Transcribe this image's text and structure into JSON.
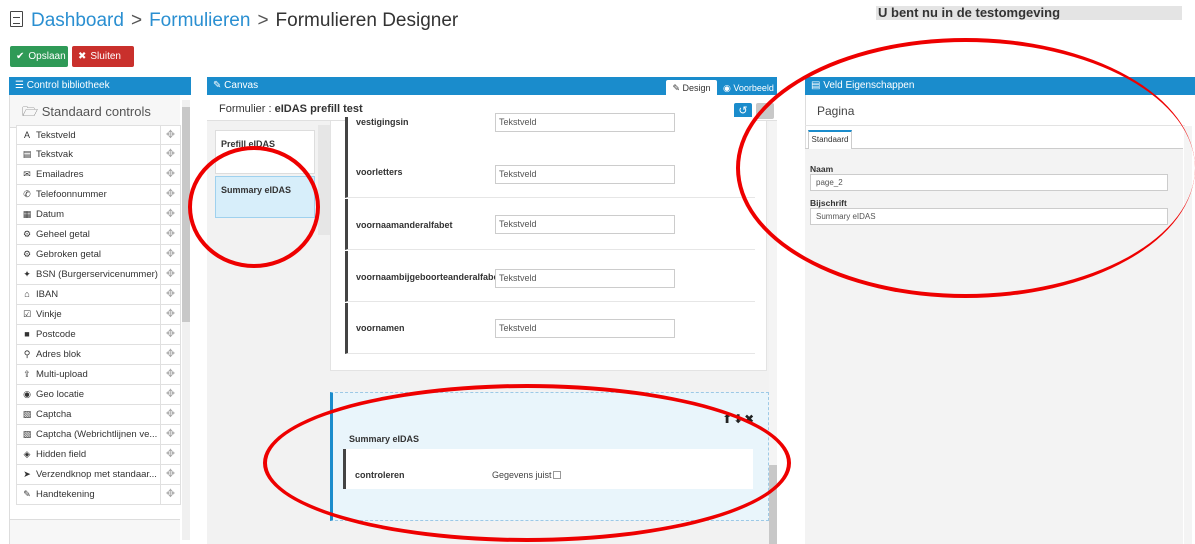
{
  "header": {
    "crumb_1": "Dashboard",
    "crumb_2": "Formulieren",
    "crumb_3": "Formulieren Designer",
    "separator": ">",
    "environment_banner": "U bent nu in de testomgeving"
  },
  "toolbar": {
    "save_label": "Opslaan",
    "close_label": "Sluiten"
  },
  "library": {
    "panel_title": "Control bibliotheek",
    "section_title": "Standaard controls",
    "items": [
      {
        "label": "Tekstveld",
        "icon": "A"
      },
      {
        "label": "Tekstvak",
        "icon": "▤"
      },
      {
        "label": "Emailadres",
        "icon": "✉"
      },
      {
        "label": "Telefoonnummer",
        "icon": "✆"
      },
      {
        "label": "Datum",
        "icon": "▦"
      },
      {
        "label": "Geheel getal",
        "icon": "⚙"
      },
      {
        "label": "Gebroken getal",
        "icon": "⚙"
      },
      {
        "label": "BSN (Burgerservicenummer)",
        "icon": "✦"
      },
      {
        "label": "IBAN",
        "icon": "⌂"
      },
      {
        "label": "Vinkje",
        "icon": "☑"
      },
      {
        "label": "Postcode",
        "icon": "■"
      },
      {
        "label": "Adres blok",
        "icon": "⚲"
      },
      {
        "label": "Multi-upload",
        "icon": "⇪"
      },
      {
        "label": "Geo locatie",
        "icon": "◉"
      },
      {
        "label": "Captcha",
        "icon": "▧"
      },
      {
        "label": "Captcha (Webrichtlijnen ve...",
        "icon": "▧"
      },
      {
        "label": "Hidden field",
        "icon": "◈"
      },
      {
        "label": "Verzendknop met standaar...",
        "icon": "➤"
      },
      {
        "label": "Handtekening",
        "icon": "✎"
      }
    ]
  },
  "canvas": {
    "panel_title": "Canvas",
    "tab_design": "Design",
    "tab_preview": "Voorbeeld",
    "form_label": "Formulier :",
    "form_name": "eIDAS prefill test",
    "pages": [
      "Prefill eIDAS",
      "Summary eIDAS"
    ],
    "fields": [
      {
        "label": "vestigingsin",
        "value": "Tekstveld"
      },
      {
        "label": "voorletters",
        "value": "Tekstveld"
      },
      {
        "label": "voornaamanderalfabet",
        "value": "Tekstveld"
      },
      {
        "label": "voornaambijgeboorteanderalfabet",
        "value": "Tekstveld"
      },
      {
        "label": "voornamen",
        "value": "Tekstveld"
      }
    ],
    "summary": {
      "title": "Summary eIDAS",
      "row_label": "controleren",
      "row_value": "Gegevens juist"
    }
  },
  "properties": {
    "panel_title": "Veld Eigenschappen",
    "title": "Pagina",
    "tab": "Standaard",
    "name_label": "Naam",
    "name_value": "page_2",
    "caption_label": "Bijschrift",
    "caption_value": "Summary eIDAS"
  },
  "colors": {
    "accent": "#1a8ccc",
    "save": "#2f9a57",
    "close": "#c9302c",
    "annotation": "#e00000"
  }
}
